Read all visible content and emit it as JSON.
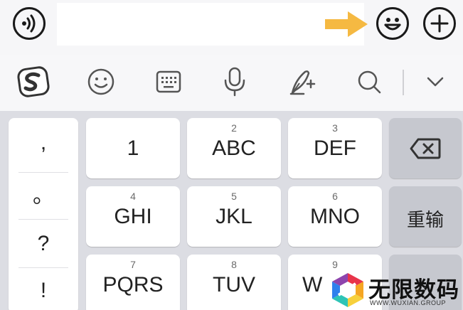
{
  "topbar": {
    "voice_icon": "voice-wave-icon",
    "input_value": "",
    "emoji_icon": "smiley-face-icon",
    "plus_icon": "plus-icon",
    "arrow_icon": "arrow-right-icon",
    "arrow_color": "#f5b942"
  },
  "toolbar": {
    "icons": [
      "sogou-logo-icon",
      "emoji-face-icon",
      "keyboard-icon",
      "microphone-icon",
      "quill-pen-icon",
      "search-icon",
      "chevron-down-icon"
    ]
  },
  "keyboard": {
    "punctuation": [
      ",",
      "。",
      "?",
      "!"
    ],
    "keys": [
      {
        "sub": "",
        "main": "1"
      },
      {
        "sub": "2",
        "main": "ABC"
      },
      {
        "sub": "3",
        "main": "DEF"
      },
      {
        "sub": "4",
        "main": "GHI"
      },
      {
        "sub": "5",
        "main": "JKL"
      },
      {
        "sub": "6",
        "main": "MNO"
      },
      {
        "sub": "7",
        "main": "PQRS"
      },
      {
        "sub": "8",
        "main": "TUV"
      },
      {
        "sub": "9",
        "main": "W"
      }
    ],
    "delete_icon": "backspace-icon",
    "reinput_label": "重输"
  },
  "watermark": {
    "title": "无限数码",
    "subtitle": "WWW.WUXIAN.GROUP"
  }
}
